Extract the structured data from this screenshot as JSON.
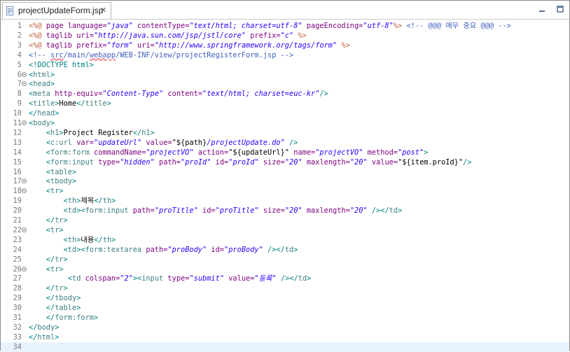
{
  "tab": {
    "title": "projectUpdateForm.jsp",
    "close_icon": "✕"
  },
  "lines": [
    {
      "n": "1"
    },
    {
      "n": "2"
    },
    {
      "n": "3"
    },
    {
      "n": "4"
    },
    {
      "n": "5"
    },
    {
      "n": "6"
    },
    {
      "n": "7"
    },
    {
      "n": "8"
    },
    {
      "n": "9"
    },
    {
      "n": "10"
    },
    {
      "n": "11"
    },
    {
      "n": "12"
    },
    {
      "n": "13"
    },
    {
      "n": "14"
    },
    {
      "n": "15"
    },
    {
      "n": "16"
    },
    {
      "n": "17"
    },
    {
      "n": "18"
    },
    {
      "n": "19"
    },
    {
      "n": "20"
    },
    {
      "n": "21"
    },
    {
      "n": "22"
    },
    {
      "n": "23"
    },
    {
      "n": "24"
    },
    {
      "n": "25"
    },
    {
      "n": "26"
    },
    {
      "n": "27"
    },
    {
      "n": "28"
    },
    {
      "n": "29"
    },
    {
      "n": "30"
    },
    {
      "n": "31"
    },
    {
      "n": "32"
    },
    {
      "n": "33"
    },
    {
      "n": "34"
    }
  ],
  "code": {
    "l1": [
      "<%@ ",
      "page ",
      "language=",
      "\"java\"",
      " contentType=",
      "\"text/html; charset=utf-8\"",
      " pageEncoding=",
      "\"utf-8\"",
      "%>",
      " <!-- @@@ 매우 중요 @@@ -->"
    ],
    "l2": [
      "<%@ ",
      "taglib ",
      "uri=",
      "\"http://java.sun.com/jsp/jstl/core\"",
      " prefix=",
      "\"c\"",
      " %>"
    ],
    "l3": [
      "<%@ ",
      "taglib ",
      "prefix=",
      "\"form\"",
      " uri=",
      "\"http://www.springframework.org/tags/form\"",
      " %>"
    ],
    "l4": [
      "<!-- ",
      "src",
      "/main/",
      "webapp",
      "/WEB-INF/view/projectRegisterForm.jsp -->"
    ],
    "l5": [
      "<!DOCTYPE ",
      "html",
      ">"
    ],
    "l6": [
      "<",
      "html",
      ">"
    ],
    "l7": [
      "<",
      "head",
      ">"
    ],
    "l8": [
      "<",
      "meta",
      " http-equiv=",
      "\"Content-Type\"",
      " content=",
      "\"text/html; charset=euc-kr\"",
      "/>"
    ],
    "l9": [
      "<",
      "title",
      ">",
      "Home",
      "</",
      "title",
      ">"
    ],
    "l10": [
      "</",
      "head",
      ">"
    ],
    "l11": [
      "<",
      "body",
      ">"
    ],
    "l12": [
      "    <",
      "h1",
      ">",
      "Project Register",
      "</",
      "h1",
      ">"
    ],
    "l13": [
      "    <",
      "c:url",
      " var=",
      "\"updateUrl\"",
      " value=",
      "\"${path}",
      "/projectUpdate.do\"",
      " />"
    ],
    "l14": [
      "    <",
      "form:form",
      " commandName=",
      "\"projectVO\"",
      " action=",
      "\"${updateUrl}\"",
      " name=",
      "\"projectVO\"",
      " method=",
      "\"post\"",
      ">"
    ],
    "l15": [
      "    <",
      "form:input",
      " type=",
      "\"hidden\"",
      " path=",
      "\"proId\"",
      " id=",
      "\"proId\"",
      " size=",
      "\"20\"",
      " maxlength=",
      "\"20\"",
      " value=",
      "\"${item.proId}\"",
      "/>"
    ],
    "l16": [
      "    <",
      "table",
      ">"
    ],
    "l17": [
      "    <",
      "tbody",
      ">"
    ],
    "l18": [
      "    <",
      "tr",
      ">"
    ],
    "l19": [
      "        <",
      "th",
      ">",
      "제목",
      "</",
      "th",
      ">"
    ],
    "l20": [
      "        <",
      "td",
      "><",
      "form:input",
      " path=",
      "\"proTitle\"",
      " id=",
      "\"proTitle\"",
      " size=",
      "\"20\"",
      " maxlength=",
      "\"20\"",
      " /></",
      "td",
      ">"
    ],
    "l21": [
      "    </",
      "tr",
      ">"
    ],
    "l22": [
      "    <",
      "tr",
      ">"
    ],
    "l23": [
      "        <",
      "th",
      ">",
      "내용",
      "</",
      "th",
      ">"
    ],
    "l24": [
      "        <",
      "td",
      "><",
      "form:textarea",
      " path=",
      "\"proBody\"",
      " id=",
      "\"proBody\"",
      " /></",
      "td",
      ">"
    ],
    "l25": [
      "    </",
      "tr",
      ">"
    ],
    "l26": [
      "    <",
      "tr",
      ">"
    ],
    "l27": [
      "         <",
      "td",
      " colspan=",
      "\"2\"",
      "><",
      "input",
      " type=",
      "\"submit\"",
      " value=",
      "\"등록\"",
      " /></",
      "td",
      ">"
    ],
    "l28": [
      "    </",
      "tr",
      ">"
    ],
    "l29": [
      "    </",
      "tbody",
      ">"
    ],
    "l30": [
      "    </",
      "table",
      ">"
    ],
    "l31": [
      "    </",
      "form:form",
      ">"
    ],
    "l32": [
      "</",
      "body",
      ">"
    ],
    "l33": [
      "</",
      "html",
      ">"
    ],
    "l34": []
  },
  "colors": {
    "tag": "#3f7f7f",
    "attr": "#7f007f",
    "value": "#2a00ff",
    "comment": "#3f5fbf",
    "current_line": "#e8f2fe"
  }
}
